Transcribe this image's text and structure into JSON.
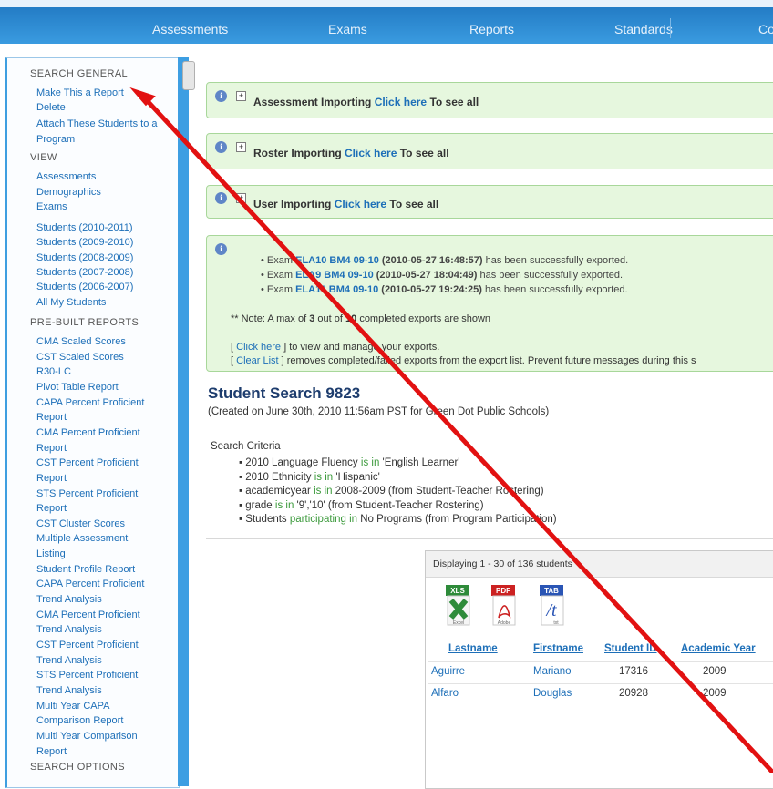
{
  "nav": {
    "items": [
      "Assessments",
      "Exams",
      "Reports",
      "Standards",
      "Co"
    ]
  },
  "sidebar": {
    "search_general_heading": "SEARCH GENERAL",
    "search_general_items": [
      "Make This a Report",
      "Delete",
      "Attach These Students to a",
      "Program"
    ],
    "view_heading": "VIEW",
    "view_items": [
      "Assessments",
      "Demographics",
      "Exams"
    ],
    "student_items": [
      "Students (2010-2011)",
      "Students (2009-2010)",
      "Students (2008-2009)",
      "Students (2007-2008)",
      "Students (2006-2007)",
      "All My Students"
    ],
    "prebuilt_heading": "PRE-BUILT REPORTS",
    "prebuilt_items": [
      "CMA Scaled Scores",
      "CST Scaled Scores",
      "R30-LC",
      "Pivot Table Report",
      "CAPA Percent Proficient",
      "Report",
      "CMA Percent Proficient",
      "Report",
      "CST Percent Proficient",
      "Report",
      "STS Percent Proficient",
      "Report",
      "CST Cluster Scores",
      "Multiple Assessment",
      "Listing",
      "Student Profile Report",
      "CAPA Percent Proficient",
      "Trend Analysis",
      "CMA Percent Proficient",
      "Trend Analysis",
      "CST Percent Proficient",
      "Trend Analysis",
      "STS Percent Proficient",
      "Trend Analysis",
      "Multi Year CAPA",
      "Comparison Report",
      "Multi Year Comparison",
      "Report"
    ],
    "search_options_heading": "SEARCH OPTIONS"
  },
  "panels": {
    "assessment": {
      "title": "Assessment Importing",
      "link": "Click here",
      "suffix": "To see all"
    },
    "roster": {
      "title": "Roster Importing",
      "link": "Click here",
      "suffix": "To see all"
    },
    "user": {
      "title": "User Importing",
      "link": "Click here",
      "suffix": "To see all"
    }
  },
  "exports": {
    "lines": [
      {
        "prefix": "Exam",
        "name": "ELA10 BM4 09-10",
        "date": "(2010-05-27 16:48:57)",
        "suffix": "has been successfully exported."
      },
      {
        "prefix": "Exam",
        "name": "ELA9 BM4 09-10",
        "date": "(2010-05-27 18:04:49)",
        "suffix": "has been successfully exported."
      },
      {
        "prefix": "Exam",
        "name": "ELA11 BM4 09-10",
        "date": "(2010-05-27 19:24:25)",
        "suffix": "has been successfully exported."
      }
    ],
    "note_prefix": "** Note: A max of",
    "note_shown": "3",
    "note_mid": "out of",
    "note_total": "10",
    "note_suffix": "completed exports are shown",
    "click_here": "Click here",
    "click_here_suffix": "] to view and manage your exports.",
    "clear_list": "Clear List",
    "clear_list_suffix": "] removes completed/failed exports from the export list. Prevent future messages during this s"
  },
  "search": {
    "title": "Student Search 9823",
    "created": "(Created on June 30th, 2010 11:56am PST for Green Dot Public Schools)",
    "criteria_label": "Search Criteria",
    "criteria": [
      {
        "a": "2010 Language Fluency",
        "op": "is in",
        "b": "'English Learner'"
      },
      {
        "a": "2010 Ethnicity",
        "op": "is in",
        "b": "'Hispanic'"
      },
      {
        "a": "academicyear",
        "op": "is in",
        "b": "2008-2009 (from Student-Teacher Rostering)"
      },
      {
        "a": "grade",
        "op": "is in",
        "b": "'9','10' (from Student-Teacher Rostering)"
      },
      {
        "a": "Students",
        "op": "participating in",
        "b": "No Programs (from Program Participation)"
      }
    ]
  },
  "results": {
    "displaying": "Displaying 1 - 30 of 136 students",
    "file_icons": [
      {
        "tag": "XLS",
        "label": "Excel",
        "color": "#2e8b3a"
      },
      {
        "tag": "PDF",
        "label": "Adobe",
        "color": "#cc2222"
      },
      {
        "tag": "TAB",
        "label": "txt",
        "color": "#2a55b5"
      }
    ],
    "columns": [
      "Lastname",
      "Firstname",
      "Student ID",
      "Academic Year"
    ],
    "rows": [
      [
        "Aguirre",
        "Mariano",
        "17316",
        "2009"
      ],
      [
        "Alfaro",
        "Douglas",
        "20928",
        "2009"
      ]
    ]
  },
  "annotation": {
    "color": "#e21111"
  }
}
